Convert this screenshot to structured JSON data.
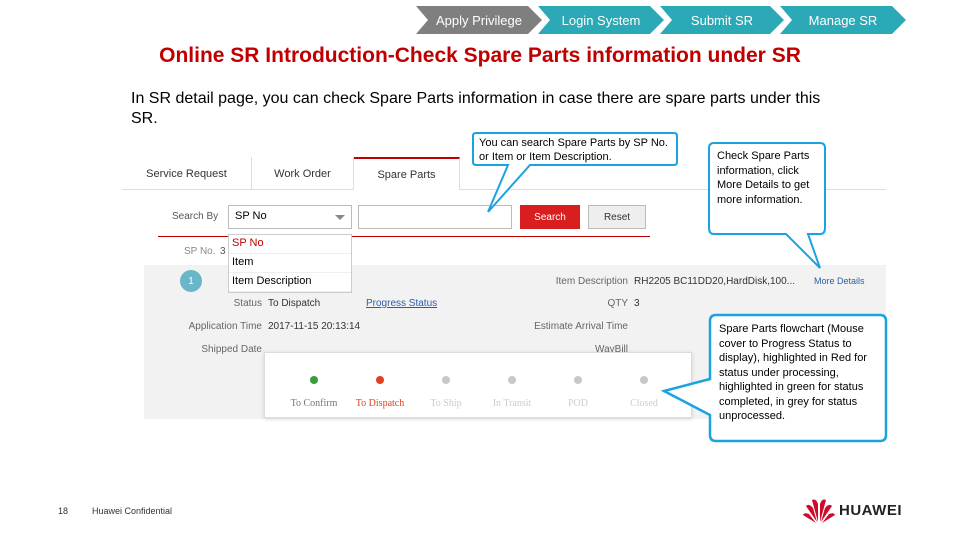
{
  "process": {
    "steps": [
      "Apply Privilege",
      "Login System",
      "Submit SR",
      "Manage SR"
    ],
    "colors": [
      "#7f7f7f",
      "#2ba9b6",
      "#2ba9b6",
      "#2ba9b6"
    ]
  },
  "title": "Online SR Introduction-Check Spare Parts information under SR",
  "intro": "In SR detail page, you can check Spare Parts information in case there are spare parts under this SR.",
  "tabs": [
    "Service Request",
    "Work Order",
    "Spare Parts"
  ],
  "search": {
    "label": "Search By",
    "selected": "SP No",
    "search_button": "Search",
    "reset_button": "Reset",
    "options": [
      "SP No",
      "Item",
      "Item Description"
    ],
    "sp_no_label": "SP No.",
    "sp_no_value": "3"
  },
  "record": {
    "badge": "1",
    "status_label": "Status",
    "status_value": "To Dispatch",
    "progress_link": "Progress Status",
    "application_time_label": "Application Time",
    "application_time_value": "2017-11-15 20:13:14",
    "shipped_date_label": "Shipped Date",
    "item_description_label": "Item Description",
    "item_description_value": "RH2205 BC11DD20,HardDisk,100...",
    "more_details": "More Details",
    "qty_label": "QTY",
    "qty_value": "3",
    "eta_label": "Estimate Arrival Time",
    "waybill_label": "WayBill"
  },
  "flowchart": {
    "steps": [
      {
        "label": "To Confirm",
        "color": "#3c9c3c"
      },
      {
        "label": "To Dispatch",
        "color": "#e0421f"
      },
      {
        "label": "To Ship",
        "color": "#c8c8c8"
      },
      {
        "label": "In Transit",
        "color": "#c8c8c8"
      },
      {
        "label": "POD",
        "color": "#c8c8c8"
      },
      {
        "label": "Closed",
        "color": "#c8c8c8"
      }
    ]
  },
  "callouts": {
    "search": "You can search Spare Parts by SP No. or Item or Item Description.",
    "details": "Check Spare Parts information, click More Details to get more information.",
    "flowchart": "Spare Parts flowchart (Mouse cover to Progress Status to display), highlighted in Red for status under processing, highlighted in green for status completed, in grey for status unprocessed."
  },
  "footer": {
    "page_number": "18",
    "confidential": "Huawei Confidential",
    "logo_text": "HUAWEI"
  },
  "accent_color": "#c00000",
  "callout_border_color": "#1aa3e0"
}
